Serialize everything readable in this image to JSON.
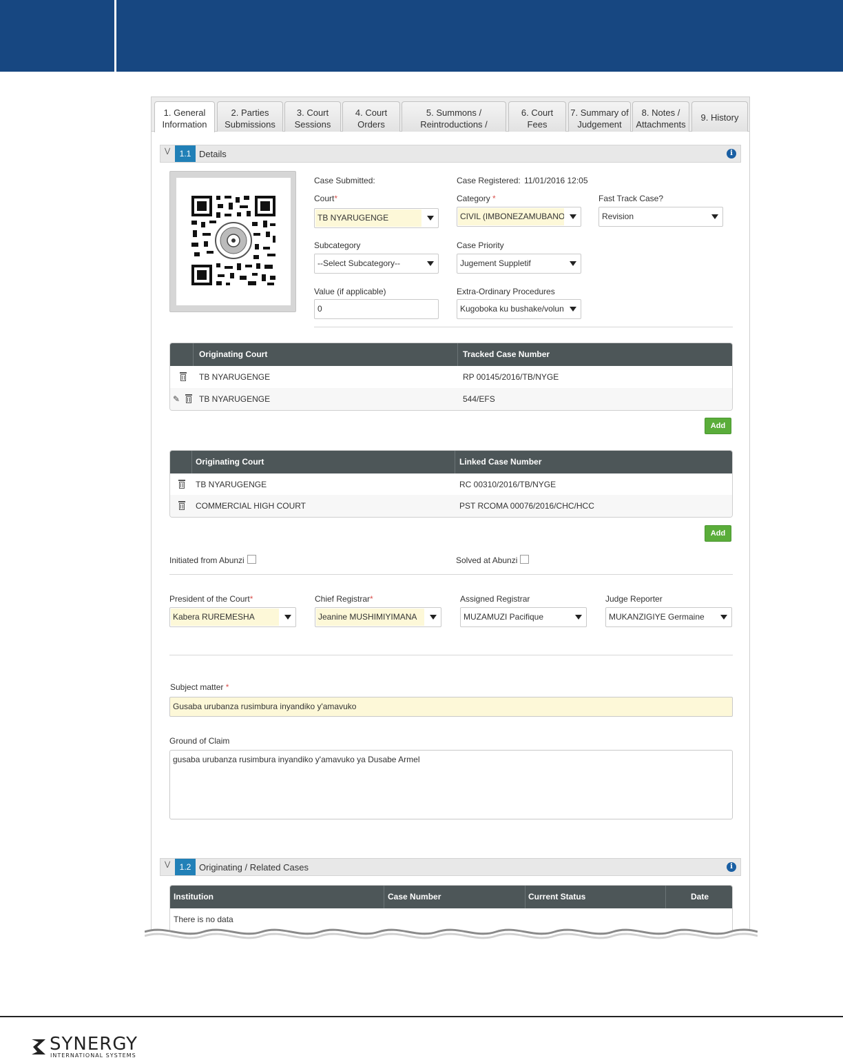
{
  "tabs": [
    {
      "label": "1. General\nInformation"
    },
    {
      "label": "2. Parties\nSubmissions"
    },
    {
      "label": "3. Court\nSessions"
    },
    {
      "label": "4. Court\nOrders"
    },
    {
      "label": "5. Summons /\nReintroductions /"
    },
    {
      "label": "6. Court\nFees"
    },
    {
      "label": "7. Summary of\nJudgement"
    },
    {
      "label": "8. Notes /\nAttachments"
    },
    {
      "label": "9. History"
    }
  ],
  "section1": {
    "number": "1.1",
    "title": "Details"
  },
  "details": {
    "case_submitted_label": "Case Submitted:",
    "case_registered_label": "Case Registered:",
    "case_registered_value": "11/01/2016 12:05",
    "court_label": "Court",
    "court_value": "TB NYARUGENGE",
    "category_label": "Category",
    "category_value": "CIVIL (IMBONEZAMUBANO)",
    "fast_track_label": "Fast Track Case?",
    "fast_track_value": "Revision",
    "subcategory_label": "Subcategory",
    "subcategory_value": "--Select Subcategory--",
    "priority_label": "Case Priority",
    "priority_value": "Jugement Suppletif",
    "value_label": "Value (if applicable)",
    "value_value": "0",
    "extra_label": "Extra-Ordinary Procedures",
    "extra_value": "Kugoboka ku bushake/voluntary",
    "required_mark": "*"
  },
  "tracked_table": {
    "headers": [
      "Originating Court",
      "Tracked Case Number"
    ],
    "rows": [
      {
        "court": "TB NYARUGENGE",
        "number": "RP 00145/2016/TB/NYGE"
      },
      {
        "court": "TB NYARUGENGE",
        "number": "544/EFS"
      }
    ]
  },
  "linked_table": {
    "headers": [
      "Originating Court",
      "Linked Case Number"
    ],
    "rows": [
      {
        "court": "TB NYARUGENGE",
        "number": "RC 00310/2016/TB/NYGE"
      },
      {
        "court": "COMMERCIAL HIGH COURT",
        "number": "PST RCOMA 00076/2016/CHC/HCC"
      }
    ]
  },
  "add_label": "Add",
  "abunzi": {
    "initiated_label": "Initiated from Abunzi",
    "solved_label": "Solved at Abunzi"
  },
  "staff": {
    "president_label": "President of the Court",
    "president_value": "Kabera RUREMESHA",
    "chief_label": "Chief Registrar",
    "chief_value": "Jeanine MUSHIMIYIMANA",
    "assigned_label": "Assigned Registrar",
    "assigned_value": "MUZAMUZI Pacifique",
    "judge_label": "Judge Reporter",
    "judge_value": "MUKANZIGIYE Germaine"
  },
  "subject": {
    "label": "Subject matter",
    "value": "Gusaba urubanza rusimbura inyandiko y'amavuko"
  },
  "ground": {
    "label": "Ground of Claim",
    "value": "gusaba urubanza rusimbura inyandiko y'amavuko ya Dusabe Armel"
  },
  "section2": {
    "number": "1.2",
    "title": "Originating / Related Cases"
  },
  "related_table": {
    "headers": [
      "Institution",
      "Case Number",
      "Current Status",
      "Date"
    ],
    "empty_text": "There is no data"
  },
  "footer": {
    "logo_text": "SYNERGY",
    "logo_sub": "INTERNATIONAL SYSTEMS"
  },
  "colors": {
    "header": "#174781",
    "accent": "#2180b7",
    "add": "#5aad3a",
    "required_bg": "#fdf8d8"
  }
}
